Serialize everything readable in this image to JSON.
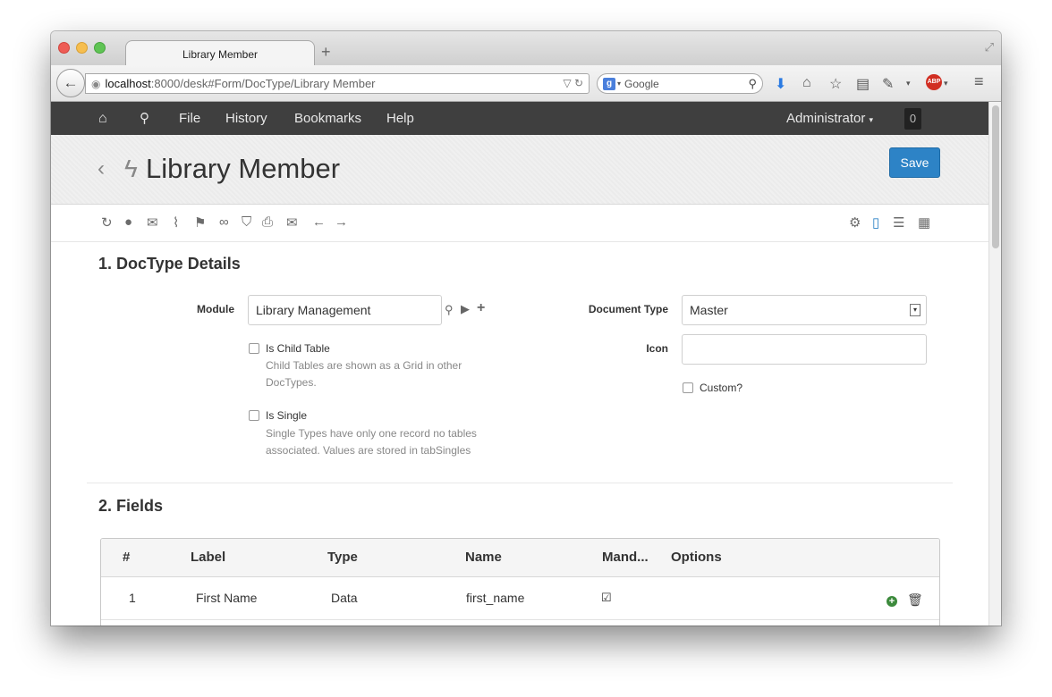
{
  "browser": {
    "tab_title": "Library Member",
    "new_tab": "+",
    "url_host": "localhost",
    "url_rest": ":8000/desk#Form/DocType/Library Member",
    "search_placeholder": "Google",
    "search_engine_letter": "g"
  },
  "navbar": {
    "items": [
      "File",
      "History",
      "Bookmarks",
      "Help"
    ],
    "user": "Administrator",
    "notifications": "0"
  },
  "page": {
    "title": "Library Member",
    "save_label": "Save"
  },
  "section1": {
    "title": "1. DocType Details",
    "module_label": "Module",
    "module_value": "Library Management",
    "document_type_label": "Document Type",
    "document_type_value": "Master",
    "icon_label": "Icon",
    "icon_value": "",
    "is_child_table_label": "Is Child Table",
    "is_child_table_help": [
      "Child Tables are shown as a Grid in other",
      "DocTypes."
    ],
    "is_single_label": "Is Single",
    "is_single_help": [
      "Single Types have only one record no tables",
      "associated. Values are stored in tabSingles"
    ],
    "custom_label": "Custom?"
  },
  "section2": {
    "title": "2. Fields",
    "columns": [
      "#",
      "Label",
      "Type",
      "Name",
      "Mand...",
      "Options"
    ],
    "rows": [
      {
        "idx": "1",
        "label": "First Name",
        "type": "Data",
        "name": "first_name",
        "mandatory": true,
        "options": ""
      }
    ]
  },
  "colors": {
    "navbar": "#3f3f3f",
    "primary_button": "#2d83c6",
    "add_row": "#3c8a3c"
  }
}
